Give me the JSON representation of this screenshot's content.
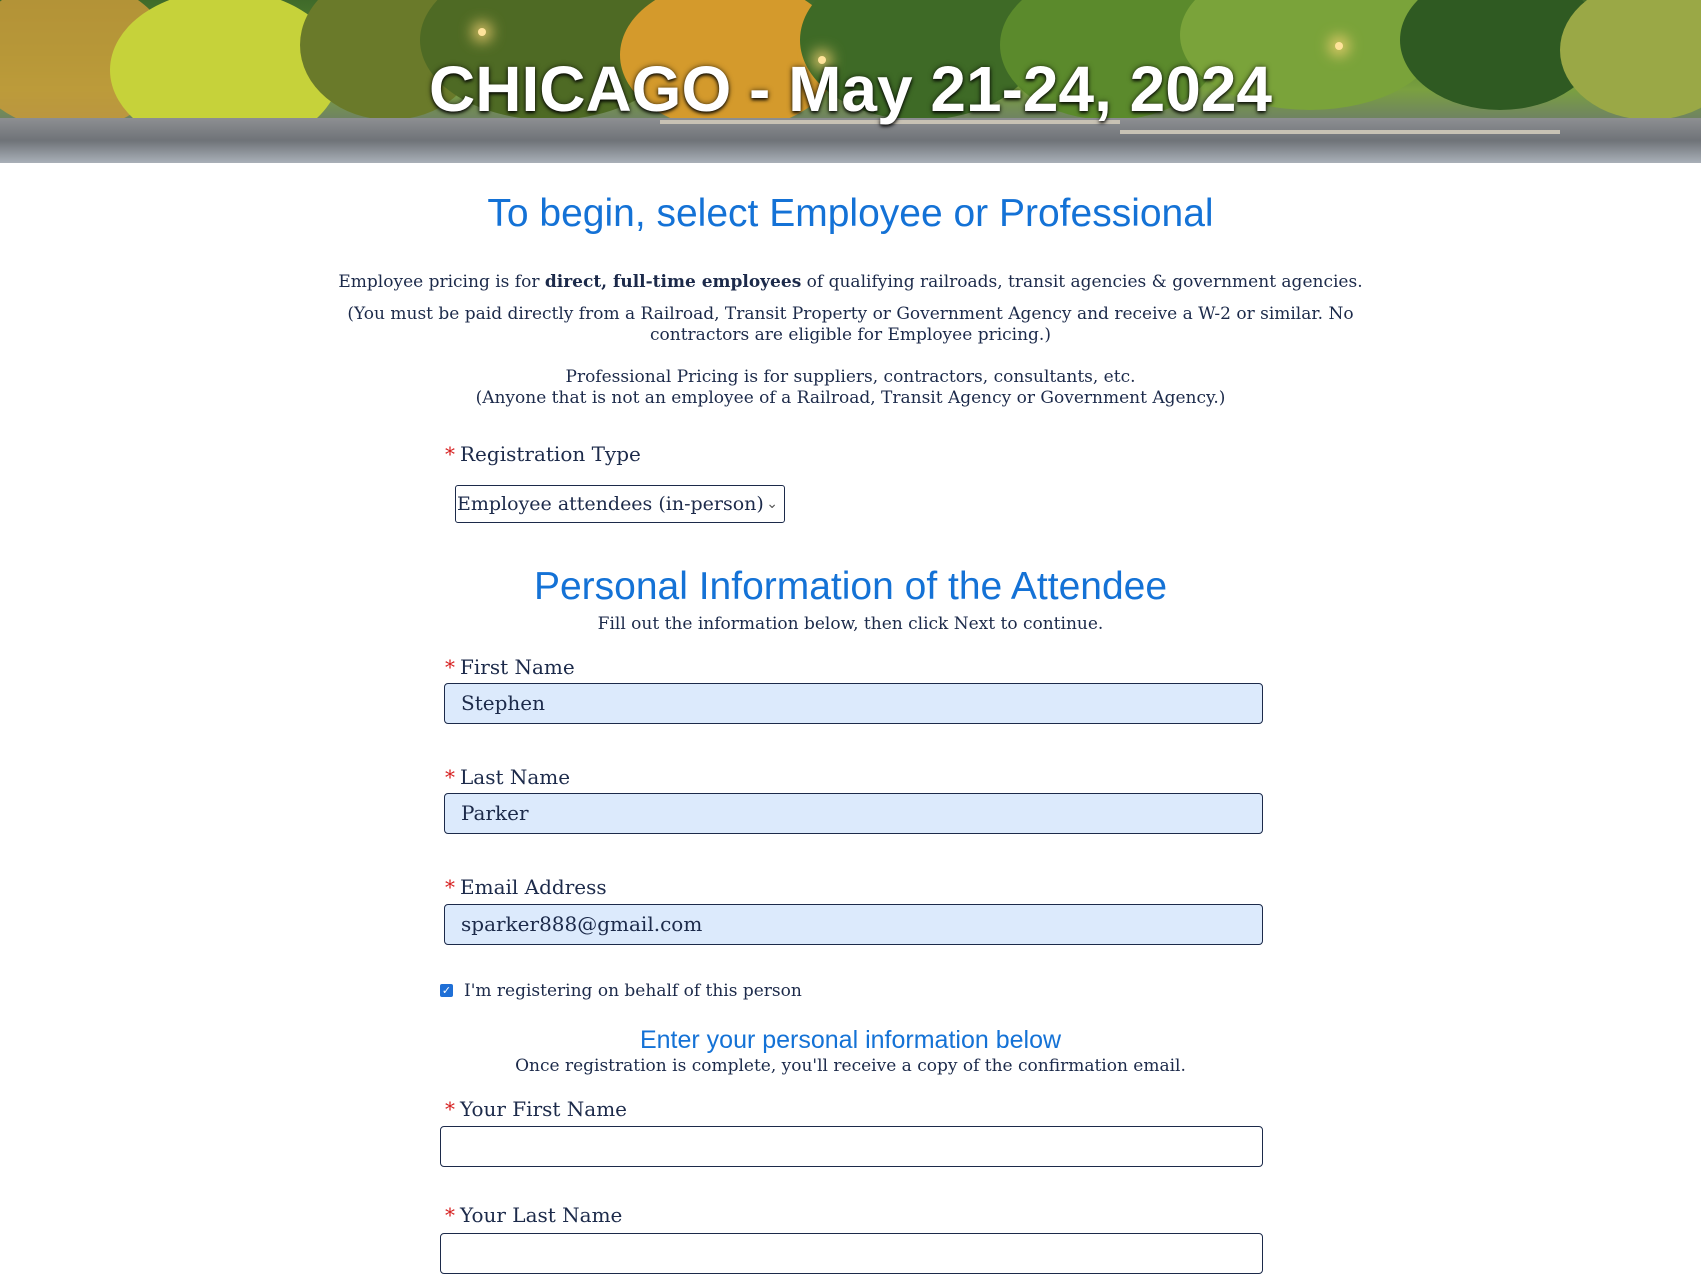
{
  "banner": {
    "title": "CHICAGO - May 21-24, 2024"
  },
  "intro": {
    "heading": "To begin, select Employee or Professional",
    "employee_line_prefix": "Employee pricing is for ",
    "employee_line_bold": "direct, full-time employees",
    "employee_line_suffix": " of qualifying railroads, transit agencies & government agencies.",
    "employee_note_line1": "(You  must be paid directly from a Railroad, Transit Property or Government  Agency and receive a W-2 or similar. No",
    "employee_note_line2": "contractors are eligible for  Employee pricing.)",
    "professional_line1": "Professional Pricing is for suppliers, contractors, consultants, etc.",
    "professional_line2": "(Anyone that is not an employee of a Railroad, Transit Agency or Government Agency.)"
  },
  "registration_type": {
    "label": "Registration Type",
    "required_mark": "*",
    "selected": "Employee attendees (in-person)",
    "chevron_icon": "chevron-down-icon"
  },
  "personal": {
    "heading": "Personal Information of the Attendee",
    "subtext": "Fill out the information below, then click Next to continue.",
    "first_name_label": "First Name",
    "first_name_value": "Stephen",
    "last_name_label": "Last Name",
    "last_name_value": "Parker",
    "email_label": "Email Address",
    "email_value": "sparker888@gmail.com",
    "on_behalf_label": "I'm registering on behalf of this person",
    "on_behalf_checked": true
  },
  "registrant": {
    "heading": "Enter your personal information below",
    "subtext": "Once registration is complete, you'll receive a copy of the confirmation email.",
    "first_name_label": "Your First Name",
    "first_name_value": "",
    "last_name_label": "Your Last Name",
    "last_name_value": ""
  },
  "colors": {
    "heading_blue": "#1472d6",
    "required_red": "#d61f1f",
    "filled_field_bg": "#dceafc"
  }
}
